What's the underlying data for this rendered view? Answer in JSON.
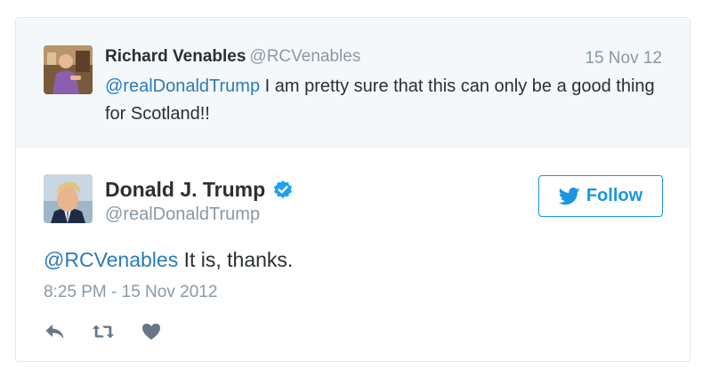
{
  "parent_tweet": {
    "author_name": "Richard Venables",
    "author_handle": "@RCVenables",
    "date": "15 Nov 12",
    "mention": "@realDonaldTrump",
    "text": " I am pretty sure that this can only be a good thing for Scotland!!"
  },
  "main_tweet": {
    "author_name": "Donald J. Trump",
    "author_handle": "@realDonaldTrump",
    "verified": true,
    "follow_label": "Follow",
    "mention": "@RCVenables",
    "text": " It is, thanks.",
    "timestamp": "8:25 PM - 15 Nov 2012"
  },
  "actions": [
    "reply-icon",
    "retweet-icon",
    "like-icon"
  ],
  "colors": {
    "link": "#2b7bb9",
    "follow": "#1b95e0",
    "muted": "#8899a6",
    "parent_bg": "#f5f8fa",
    "verified": "#1da1f2"
  }
}
